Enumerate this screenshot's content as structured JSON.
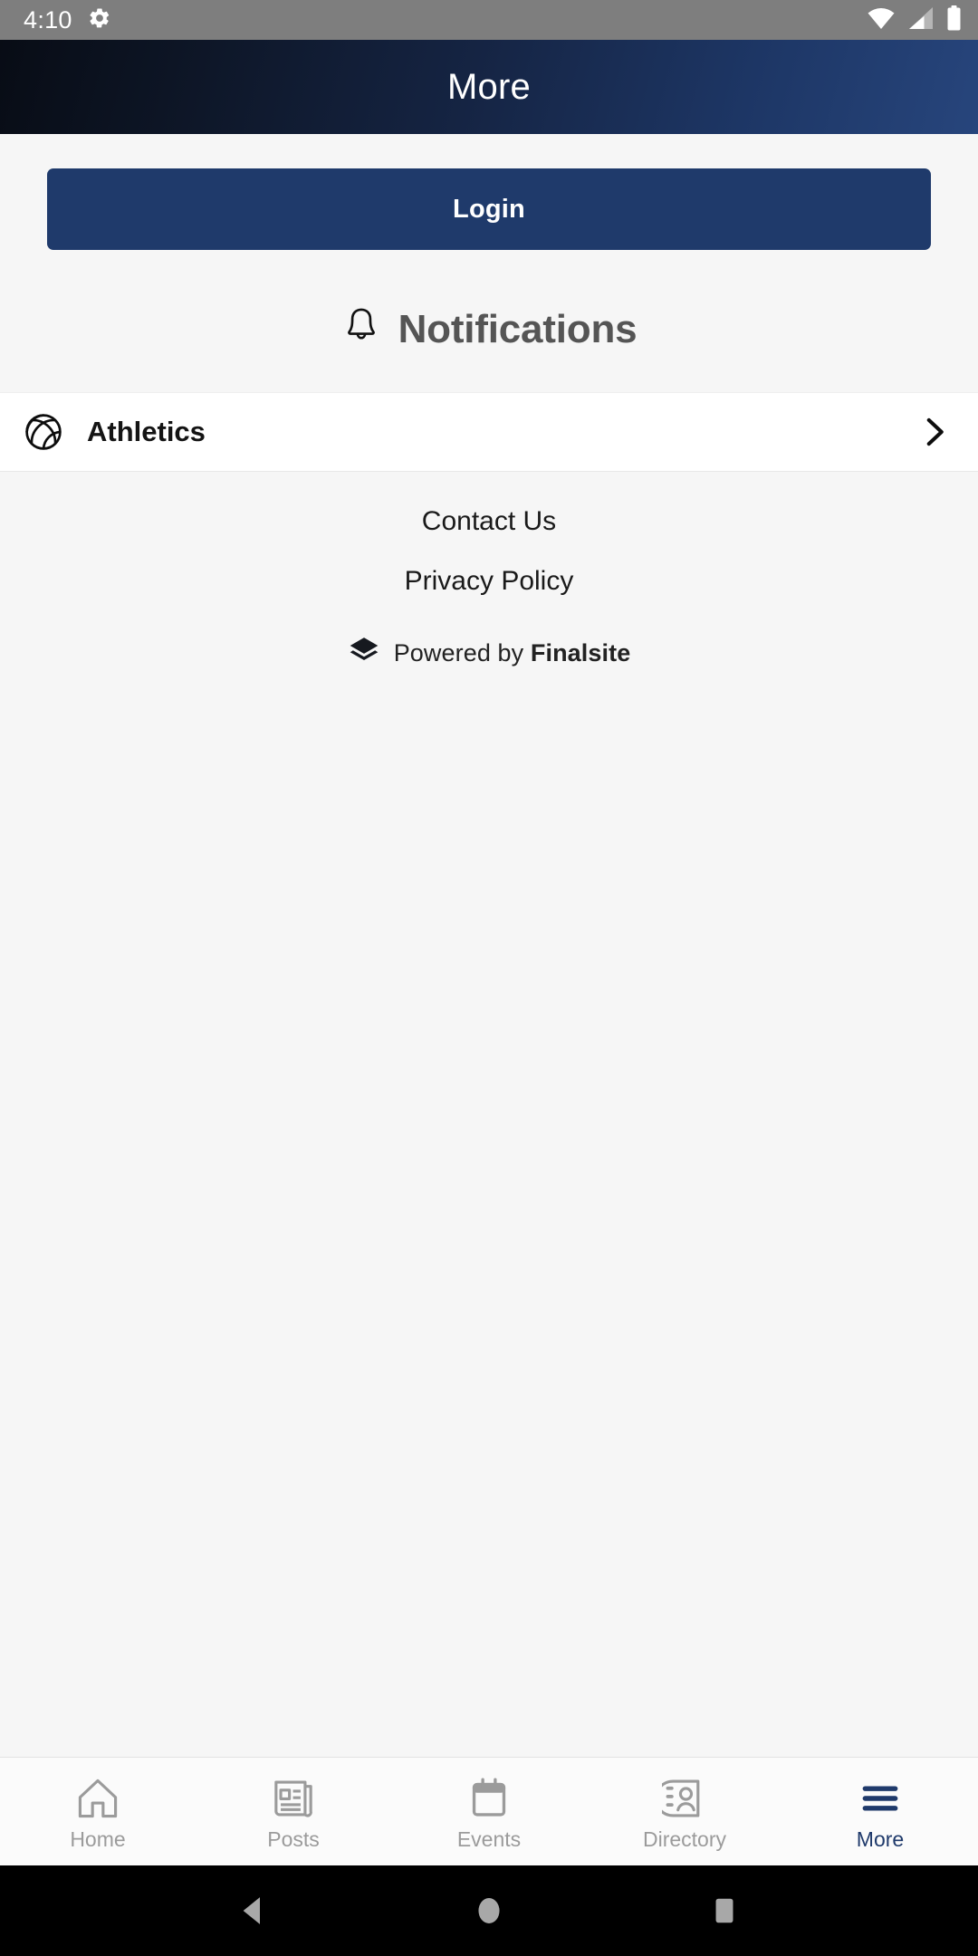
{
  "status_bar": {
    "time": "4:10",
    "icons": [
      "settings-gear-icon",
      "wifi-icon",
      "cellular-signal-icon",
      "battery-icon"
    ]
  },
  "header": {
    "title": "More",
    "gradient_from": "#080c15",
    "gradient_to": "#27457c"
  },
  "main": {
    "login_button": {
      "label": "Login",
      "color": "#1f3a6b",
      "text_color": "#ffffff"
    },
    "notifications_section": {
      "title": "Notifications",
      "icon": "bell-icon",
      "title_color": "#555555"
    },
    "notification_rows": [
      {
        "label": "Athletics",
        "icon": "basketball-icon",
        "accessory": "chevron-right-icon"
      }
    ],
    "footer_links": [
      {
        "label": "Contact Us"
      },
      {
        "label": "Privacy Policy"
      }
    ],
    "powered_by": {
      "prefix": "Powered by ",
      "brand": "Finalsite",
      "icon": "finalsite-layers-logo"
    }
  },
  "tab_bar": {
    "active_color": "#1f3a6b",
    "inactive_color": "#9b9b9b",
    "tabs": [
      {
        "label": "Home",
        "icon": "home-icon",
        "active": false
      },
      {
        "label": "Posts",
        "icon": "newspaper-icon",
        "active": false
      },
      {
        "label": "Events",
        "icon": "calendar-icon",
        "active": false
      },
      {
        "label": "Directory",
        "icon": "contact-card-icon",
        "active": false
      },
      {
        "label": "More",
        "icon": "hamburger-menu-icon",
        "active": true
      }
    ]
  },
  "android_nav": {
    "buttons": [
      {
        "name": "back-button",
        "icon": "triangle-left-icon"
      },
      {
        "name": "home-button",
        "icon": "circle-icon"
      },
      {
        "name": "recents-button",
        "icon": "square-icon"
      }
    ]
  }
}
